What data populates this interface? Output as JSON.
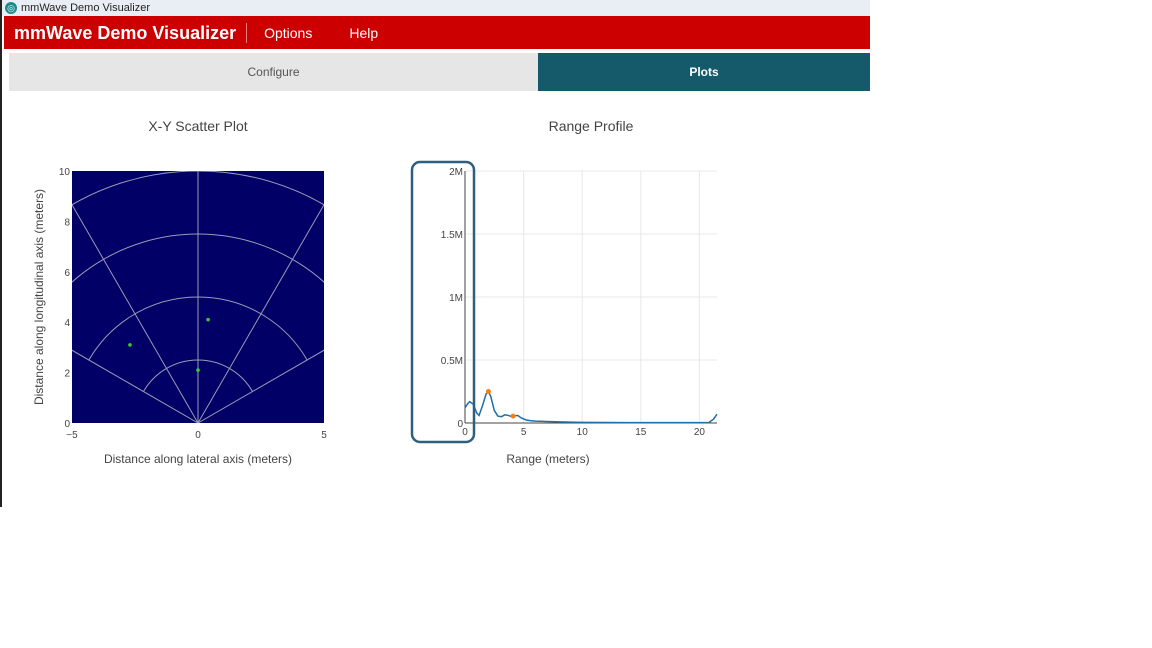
{
  "window": {
    "title": "mmWave Demo Visualizer"
  },
  "menubar": {
    "brand": "mmWave Demo Visualizer",
    "items": [
      "Options",
      "Help"
    ]
  },
  "tabs": {
    "configure": "Configure",
    "plots": "Plots"
  },
  "colors": {
    "accent": "#cc0000",
    "active_tab": "#145a6a",
    "scatter_bg": "#000066",
    "points": "#33cc33",
    "line": "#1f6fa8",
    "peak": "#ff7f0e",
    "highlight": "#2f5f7f"
  },
  "chart_data": [
    {
      "type": "scatter",
      "title": "X-Y Scatter Plot",
      "xlabel": "Distance along lateral axis (meters)",
      "ylabel": "Distance along longitudinal axis (meters)",
      "xlim": [
        -5,
        5
      ],
      "ylim": [
        0,
        10
      ],
      "xticks": [
        -5,
        0,
        5
      ],
      "xtick_labels": [
        "−5",
        "0",
        "5"
      ],
      "yticks": [
        0,
        2,
        4,
        6,
        8,
        10
      ],
      "polar_rings": [
        2.5,
        5,
        7.5,
        10
      ],
      "polar_spokes_deg": [
        30,
        60,
        90,
        120,
        150
      ],
      "points": [
        {
          "x": 0.4,
          "y": 4.1
        },
        {
          "x": -2.7,
          "y": 3.1
        },
        {
          "x": 0.0,
          "y": 2.1
        }
      ]
    },
    {
      "type": "line",
      "title": "Range Profile",
      "xlabel": "Range (meters)",
      "ylabel": "",
      "xlim": [
        0,
        21.5
      ],
      "ylim": [
        0,
        2000000
      ],
      "xticks": [
        0,
        5,
        10,
        15,
        20
      ],
      "yticks": [
        0,
        500000,
        1000000,
        1500000,
        2000000
      ],
      "ytick_labels": [
        "0",
        "0.5M",
        "1M",
        "1.5M",
        "2M"
      ],
      "series": [
        {
          "x": [
            0,
            0.2,
            0.4,
            0.7,
            1.0,
            1.2,
            1.5,
            1.8,
            2.0,
            2.2,
            2.5,
            2.8,
            3.1,
            3.4,
            3.7,
            4.0,
            4.2,
            4.5,
            4.8,
            5.2,
            5.6,
            6.0,
            7,
            8,
            9,
            10,
            12,
            14,
            16,
            18,
            20,
            20.8,
            21.2,
            21.5
          ],
          "y": [
            120000,
            150000,
            170000,
            150000,
            80000,
            60000,
            140000,
            230000,
            250000,
            210000,
            100000,
            55000,
            50000,
            65000,
            60000,
            50000,
            55000,
            60000,
            40000,
            25000,
            18000,
            15000,
            12000,
            9000,
            7000,
            5000,
            4000,
            3000,
            2500,
            2500,
            3000,
            4000,
            30000,
            70000
          ]
        }
      ],
      "peaks": [
        {
          "x": 2.0,
          "y": 250000
        },
        {
          "x": 4.1,
          "y": 55000
        }
      ]
    }
  ]
}
